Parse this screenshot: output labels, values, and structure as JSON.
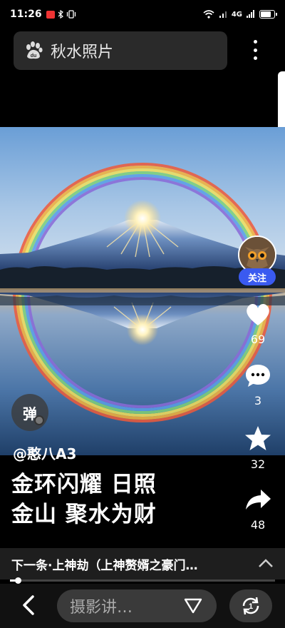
{
  "status_bar": {
    "time": "11:26",
    "network": "4G",
    "battery_percent": 85
  },
  "search": {
    "title": "秋水照片",
    "icon": "baidu-paw-icon"
  },
  "post": {
    "author": "@憨八A3",
    "caption_line1": "金环闪耀 日照",
    "caption_line2": "金山 聚水为财",
    "danmaku_label": "弹"
  },
  "actions": {
    "follow_label": "关注",
    "likes": "69",
    "comments": "3",
    "favorites": "32",
    "shares": "48"
  },
  "next_item": {
    "text": "下一条·上神劫（上神赘婿之豪门…"
  },
  "progress": {
    "played_fraction": 0.03
  },
  "bottom": {
    "input_placeholder": "摄影讲…"
  },
  "colors": {
    "follow_button": "#3a5af0",
    "background": "#000000"
  }
}
